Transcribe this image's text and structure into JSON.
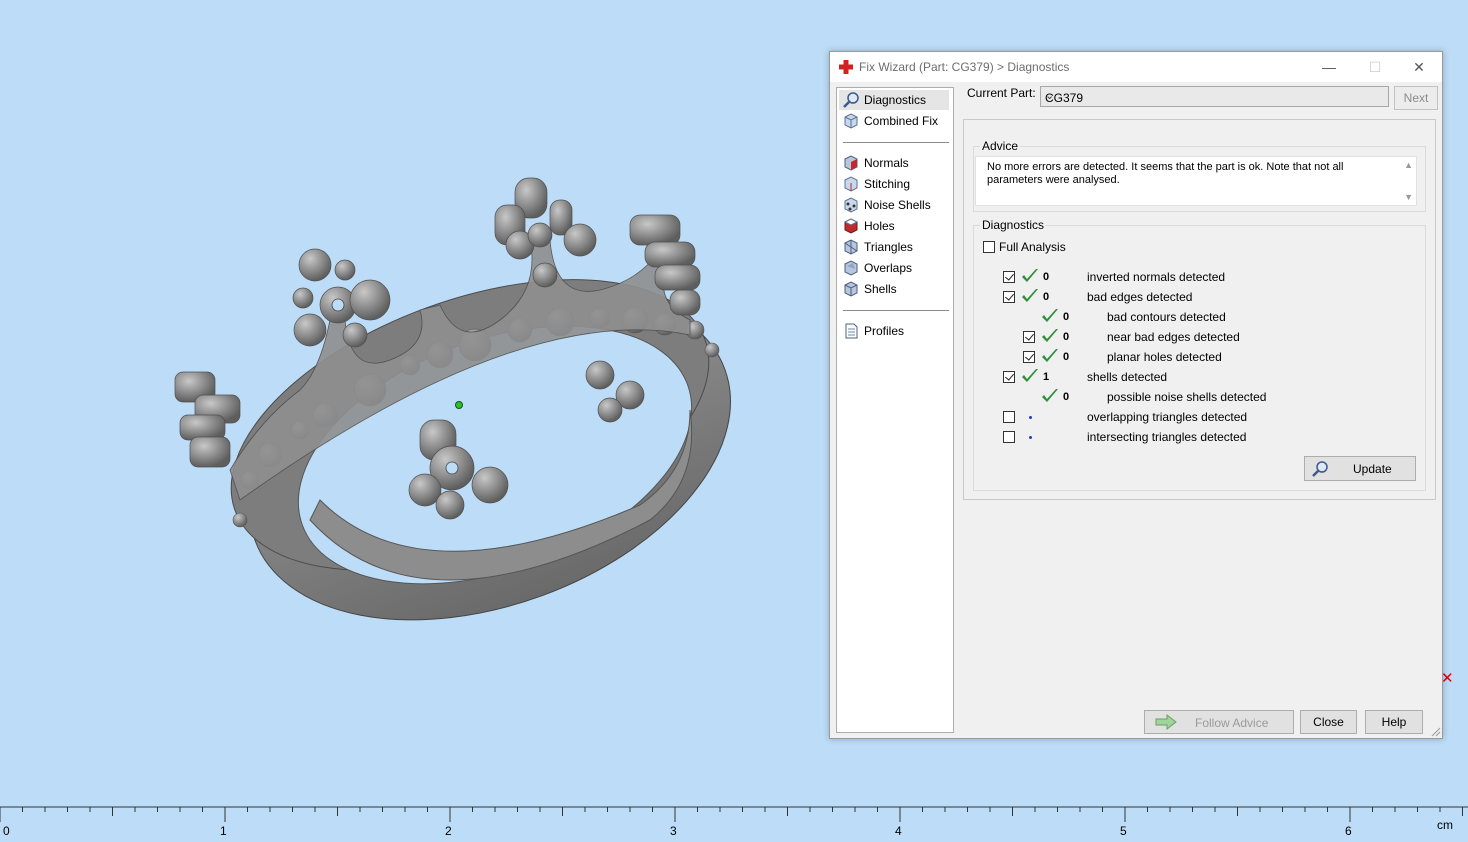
{
  "dialog": {
    "title": "Fix Wizard (Part: CG379) > Diagnostics",
    "window_buttons": {
      "minimize": "—",
      "maximize": "☐",
      "close": "✕"
    }
  },
  "nav": {
    "group1": [
      "Diagnostics",
      "Combined Fix"
    ],
    "group2": [
      "Normals",
      "Stitching",
      "Noise Shells",
      "Holes",
      "Triangles",
      "Overlaps",
      "Shells"
    ],
    "group3": [
      "Profiles"
    ],
    "selected": "Diagnostics"
  },
  "current_part": {
    "label": "Current Part:",
    "value": "CG379"
  },
  "next_label": "Next",
  "advice": {
    "title": "Advice",
    "text": "No more errors are detected. It seems that the part is ok. Note that not all parameters were analysed."
  },
  "diagnostics": {
    "title": "Diagnostics",
    "full_analysis_label": "Full Analysis",
    "full_analysis_checked": false,
    "rows": [
      {
        "checkbox": true,
        "checked": true,
        "status": "ok",
        "count": "0",
        "label": "inverted normals detected"
      },
      {
        "checkbox": true,
        "checked": true,
        "status": "ok",
        "count": "0",
        "label": "bad edges detected"
      },
      {
        "checkbox": false,
        "checked": false,
        "status": "ok",
        "count": "0",
        "label": "bad contours detected"
      },
      {
        "checkbox": true,
        "checked": true,
        "status": "ok",
        "count": "0",
        "label": "near bad edges detected"
      },
      {
        "checkbox": true,
        "checked": true,
        "status": "ok",
        "count": "0",
        "label": "planar holes detected"
      },
      {
        "checkbox": true,
        "checked": true,
        "status": "ok",
        "count": "1",
        "label": "shells detected"
      },
      {
        "checkbox": false,
        "checked": false,
        "status": "ok",
        "count": "0",
        "label": "possible noise shells detected"
      },
      {
        "checkbox": true,
        "checked": false,
        "status": "pending",
        "count": "",
        "label": "overlapping triangles detected"
      },
      {
        "checkbox": true,
        "checked": false,
        "status": "pending",
        "count": "",
        "label": "intersecting triangles detected"
      }
    ],
    "update_label": "Update"
  },
  "buttons": {
    "follow_advice": "Follow Advice",
    "close": "Close",
    "help": "Help"
  },
  "ruler": {
    "ticks": [
      "0",
      "1",
      "2",
      "3",
      "4",
      "5",
      "6"
    ],
    "unit": "cm"
  },
  "colors": {
    "background": "#bcdcf7",
    "check_green": "#2f8f3a",
    "model_gray": "#8a8a8a"
  }
}
